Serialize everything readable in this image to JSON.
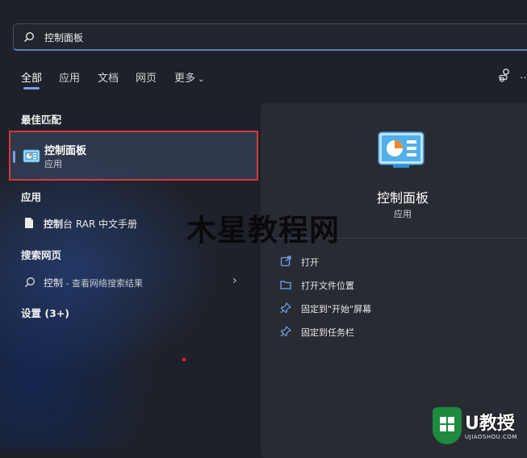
{
  "search": {
    "value": "控制面板"
  },
  "tabs": [
    {
      "label": "全部"
    },
    {
      "label": "应用"
    },
    {
      "label": "文档"
    },
    {
      "label": "网页"
    },
    {
      "label": "更多"
    }
  ],
  "overflow_label": "…",
  "sections": {
    "best_match": "最佳匹配",
    "apps": "应用",
    "web": "搜索网页",
    "settings": "设置 (3+)"
  },
  "best_match_item": {
    "name": "控制面板",
    "type": "应用"
  },
  "app_results": [
    {
      "name_bold": "控制",
      "name_rest": "台 RAR 中文手册"
    }
  ],
  "web_results": [
    {
      "query": "控制",
      "suffix": " - 查看网络搜索结果"
    }
  ],
  "details": {
    "name": "控制面板",
    "type": "应用",
    "actions": [
      {
        "label": "打开",
        "icon": "open-external-icon"
      },
      {
        "label": "打开文件位置",
        "icon": "folder-icon"
      },
      {
        "label": "固定到\"开始\"屏幕",
        "icon": "pin-icon"
      },
      {
        "label": "固定到任务栏",
        "icon": "pin-icon"
      }
    ]
  },
  "watermark": "木星教程网",
  "logo": {
    "text": "U教授",
    "sub": "UJIAOSHOU.COM"
  },
  "colors": {
    "accent": "#6ea3e6",
    "highlight_border": "#d6373b",
    "logo_green": "#1e8a3e"
  }
}
